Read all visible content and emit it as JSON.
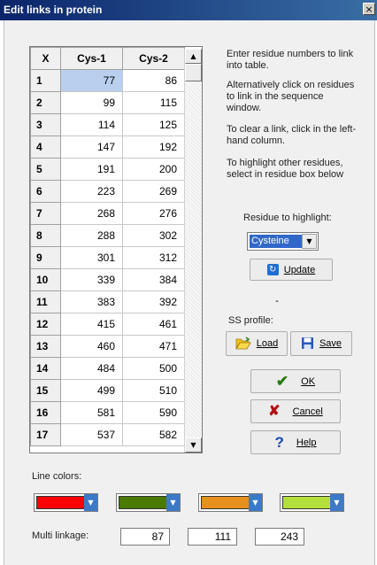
{
  "window": {
    "title": "Edit links in protein",
    "close_glyph": "×"
  },
  "grid": {
    "columns": [
      "X",
      "Cys-1",
      "Cys-2"
    ],
    "rows": [
      [
        "1",
        "77",
        "86"
      ],
      [
        "2",
        "99",
        "115"
      ],
      [
        "3",
        "114",
        "125"
      ],
      [
        "4",
        "147",
        "192"
      ],
      [
        "5",
        "191",
        "200"
      ],
      [
        "6",
        "223",
        "269"
      ],
      [
        "7",
        "268",
        "276"
      ],
      [
        "8",
        "288",
        "302"
      ],
      [
        "9",
        "301",
        "312"
      ],
      [
        "10",
        "339",
        "384"
      ],
      [
        "11",
        "383",
        "392"
      ],
      [
        "12",
        "415",
        "461"
      ],
      [
        "13",
        "460",
        "471"
      ],
      [
        "14",
        "484",
        "500"
      ],
      [
        "15",
        "499",
        "510"
      ],
      [
        "16",
        "581",
        "590"
      ],
      [
        "17",
        "537",
        "582"
      ]
    ],
    "selected_cell": "1-Cys-1"
  },
  "instructions": {
    "p1": "Enter residue numbers to link into table.",
    "p2": "Alternatively click on residues to link in the sequence window.",
    "p3": "To clear a link, click in the left-hand column.",
    "p4": "To highlight other residues, select in residue box below"
  },
  "highlight": {
    "label": "Residue to highlight:",
    "selected": "Cysteine",
    "update_label": "Update"
  },
  "status_dash": "-",
  "ss_profile": {
    "label": "SS profile:",
    "load_label": "Load",
    "save_label": "Save"
  },
  "actions": {
    "ok_label": "OK",
    "cancel_label": "Cancel",
    "help_label": "Help"
  },
  "line_colors": {
    "label": "Line colors:",
    "swatches": [
      "#ff0000",
      "#4a7a00",
      "#e8901c",
      "#b4e03c"
    ]
  },
  "multi_linkage": {
    "label": "Multi linkage:",
    "values": [
      "87",
      "111",
      "243"
    ]
  },
  "icons": {
    "update": "refresh-icon",
    "load": "folder-open-icon",
    "save": "floppy-disk-icon",
    "ok": "checkmark-icon",
    "cancel": "x-mark-icon",
    "help": "question-mark-icon"
  }
}
